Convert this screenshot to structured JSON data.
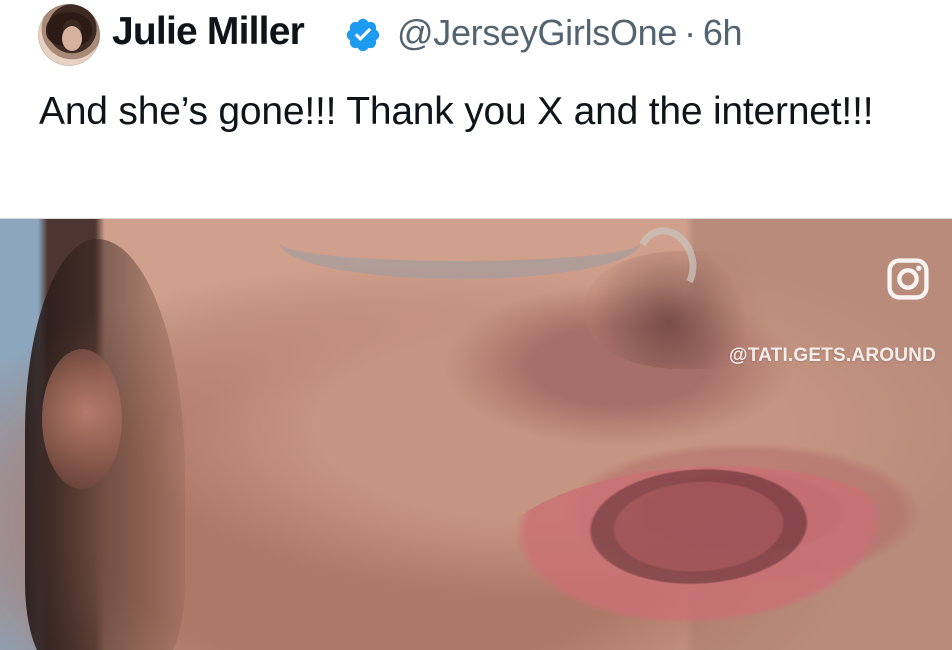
{
  "tweet": {
    "author": {
      "name": "Julie Miller",
      "handle": "@JerseyGirlsOne",
      "time": "6h",
      "separator": "·",
      "avatar_icon": "profile-avatar",
      "verified_icon": "verified-badge-icon"
    },
    "text": "And she’s gone!!! Thank you X and the internet!!!",
    "media": {
      "watermark": "@TATI.GETS.AROUND",
      "watermark_icon": "instagram-icon"
    },
    "colors": {
      "text": "#0f1419",
      "secondary": "#536471",
      "verified": "#1d9bf0",
      "background": "#ffffff"
    }
  }
}
